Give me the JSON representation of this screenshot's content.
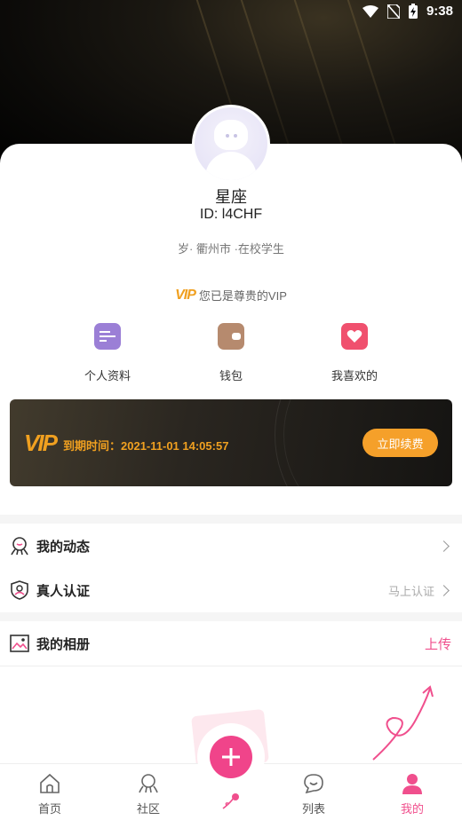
{
  "status_bar": {
    "time": "9:38"
  },
  "profile": {
    "nickname": "星座",
    "id_text": "ID: l4CHF",
    "info": "岁· 衢州市 ·在校学生",
    "vip_badge": "VIP",
    "vip_status": "您已是尊贵的VIP"
  },
  "quick_actions": [
    {
      "label": "个人资料",
      "icon": "profile-card-icon",
      "color": "#9b7fd6"
    },
    {
      "label": "钱包",
      "icon": "wallet-icon",
      "color": "#b68a6e"
    },
    {
      "label": "我喜欢的",
      "icon": "heart-icon",
      "color": "#f0506e"
    }
  ],
  "vip_banner": {
    "logo": "VIP",
    "expire_text": "到期时间：2021-11-01 14:05:57",
    "renew_label": "立即续费",
    "accent": "#f5a02a"
  },
  "menu": {
    "moments": {
      "label": "我的动态"
    },
    "verify": {
      "label": "真人认证",
      "right": "马上认证"
    },
    "album": {
      "label": "我的相册",
      "action": "上传"
    }
  },
  "tabs": [
    {
      "label": "首页",
      "icon": "home-icon",
      "active": false
    },
    {
      "label": "社区",
      "icon": "community-icon",
      "active": false
    },
    {
      "label": "",
      "icon": "rose-icon",
      "active": false
    },
    {
      "label": "列表",
      "icon": "chat-bubble-icon",
      "active": false
    },
    {
      "label": "我的",
      "icon": "person-icon",
      "active": true
    }
  ],
  "colors": {
    "brand_pink": "#f04f8d",
    "vip_gold": "#f0a020"
  }
}
